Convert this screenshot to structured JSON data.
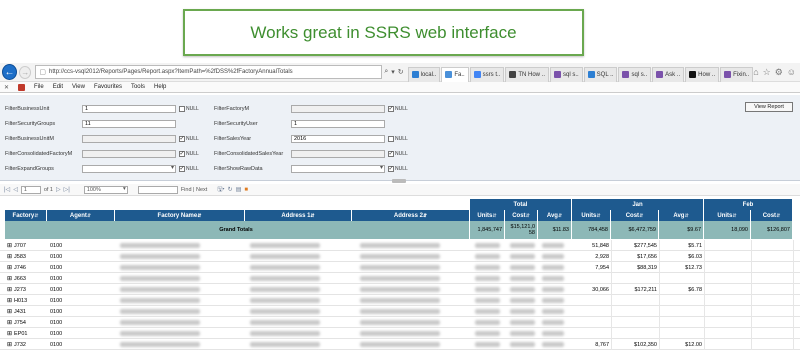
{
  "banner": {
    "text": "Works great in SSRS web interface"
  },
  "browser": {
    "url": "http://ccs-vsql2012/Reports/Pages/Report.aspx?ItemPath=%2fDSS%2fFactoryAnnualTotals",
    "tabs": [
      {
        "label": "local..",
        "color": "#2d7fd3"
      },
      {
        "label": "Fa..",
        "color": "#4a90d9",
        "active": true
      },
      {
        "label": "ssrs t..",
        "color": "#4285f4"
      },
      {
        "label": "TN How ..",
        "color": "#444444"
      },
      {
        "label": "sql s..",
        "color": "#7b52ab"
      },
      {
        "label": "SQL ..",
        "color": "#2d7fd3"
      },
      {
        "label": "sql s..",
        "color": "#7b52ab"
      },
      {
        "label": "Ask ..",
        "color": "#7b52ab"
      },
      {
        "label": "How ..",
        "color": "#111111"
      },
      {
        "label": "Fixin..",
        "color": "#7b52ab"
      }
    ],
    "menu": [
      "File",
      "Edit",
      "View",
      "Favourites",
      "Tools",
      "Help"
    ]
  },
  "params": {
    "left": [
      {
        "label": "FilterBusinessUnit",
        "value": "1",
        "null_checked": false,
        "disabled": false,
        "select": false
      },
      {
        "label": "FilterSecurityGroups",
        "value": "11",
        "null_checked": null,
        "disabled": false,
        "select": false
      },
      {
        "label": "FilterBusinessUnitM",
        "value": "",
        "null_checked": true,
        "disabled": true,
        "select": false
      },
      {
        "label": "FilterConsolidatedFactoryM",
        "value": "",
        "null_checked": true,
        "disabled": true,
        "select": false
      },
      {
        "label": "FilterExpandGroups",
        "value": "",
        "null_checked": true,
        "disabled": false,
        "select": true
      }
    ],
    "right": [
      {
        "label": "FilterFactoryM",
        "value": "",
        "null_checked": true,
        "disabled": true,
        "select": false
      },
      {
        "label": "FilterSecurityUser",
        "value": "1",
        "null_checked": null,
        "disabled": false,
        "select": false
      },
      {
        "label": "FilterSalesYear",
        "value": "2016",
        "null_checked": false,
        "disabled": false,
        "select": false
      },
      {
        "label": "FilterConsolidatedSalesYear",
        "value": "",
        "null_checked": true,
        "disabled": true,
        "select": false
      },
      {
        "label": "FilterShowRawData",
        "value": "",
        "null_checked": true,
        "disabled": false,
        "select": true
      }
    ],
    "null_label": "NULL",
    "view_report": "View Report"
  },
  "toolbar": {
    "page": "1",
    "of": "of 1",
    "zoom": "100%",
    "find_next": "Find | Next"
  },
  "report": {
    "groups": [
      {
        "label": "Total"
      },
      {
        "label": "Jan"
      },
      {
        "label": "Feb"
      }
    ],
    "columns": [
      "Factory",
      "Agent",
      "Factory Name",
      "Address 1",
      "Address 2",
      "Units",
      "Cost",
      "Avg",
      "Units",
      "Cost",
      "Avg",
      "Units",
      "Cost"
    ],
    "grand_totals": {
      "label": "Grand Totals",
      "values": [
        "1,845,747",
        "$15,121,0 58",
        "$11.83",
        "784,458",
        "$6,472,759",
        "$9.67",
        "18,090",
        "$126,807"
      ]
    },
    "rows": [
      {
        "factory": "J707",
        "agent": "0100",
        "jan_units": "51,848",
        "jan_cost": "$277,545",
        "jan_avg": "$5.71"
      },
      {
        "factory": "J583",
        "agent": "0100",
        "jan_units": "2,928",
        "jan_cost": "$17,656",
        "jan_avg": "$6.03"
      },
      {
        "factory": "J746",
        "agent": "0100",
        "jan_units": "7,954",
        "jan_cost": "$88,319",
        "jan_avg": "$12.73"
      },
      {
        "factory": "J663",
        "agent": "0100",
        "jan_units": "",
        "jan_cost": "",
        "jan_avg": ""
      },
      {
        "factory": "J273",
        "agent": "0100",
        "jan_units": "30,066",
        "jan_cost": "$172,211",
        "jan_avg": "$6.78"
      },
      {
        "factory": "H013",
        "agent": "0100",
        "jan_units": "",
        "jan_cost": "",
        "jan_avg": ""
      },
      {
        "factory": "J431",
        "agent": "0100",
        "jan_units": "",
        "jan_cost": "",
        "jan_avg": ""
      },
      {
        "factory": "J754",
        "agent": "0100",
        "jan_units": "",
        "jan_cost": "",
        "jan_avg": ""
      },
      {
        "factory": "EP01",
        "agent": "0100",
        "jan_units": "",
        "jan_cost": "",
        "jan_avg": ""
      },
      {
        "factory": "J732",
        "agent": "0100",
        "jan_units": "8,767",
        "jan_cost": "$102,350",
        "jan_avg": "$12.00"
      }
    ]
  }
}
